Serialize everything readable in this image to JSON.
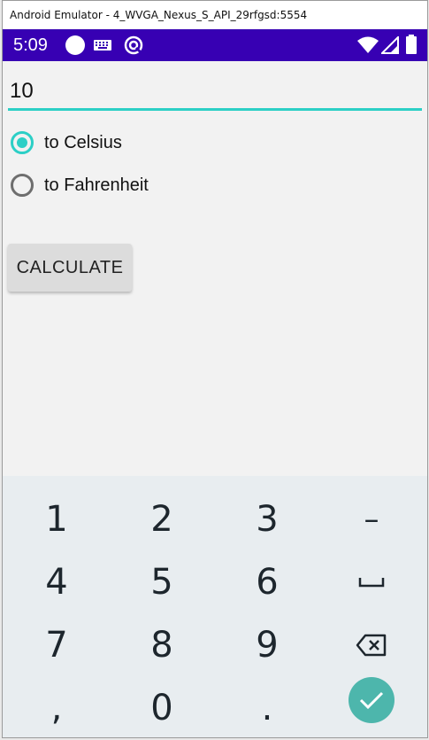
{
  "window": {
    "title": "Android Emulator - 4_WVGA_Nexus_S_API_29rfgsd:5554"
  },
  "status_bar": {
    "time": "5:09",
    "icons": [
      "circle-notification-icon",
      "keyboard-icon",
      "at-sign-icon",
      "wifi-icon",
      "signal-icon",
      "battery-icon"
    ],
    "background": "#3700b3"
  },
  "form": {
    "temperature_value": "10",
    "options": [
      {
        "label": "to Celsius",
        "checked": true
      },
      {
        "label": "to Fahrenheit",
        "checked": false
      }
    ],
    "calculate_label": "CALCULATE",
    "accent": "#2ccfc6"
  },
  "keyboard": {
    "row1": [
      "1",
      "2",
      "3",
      "–"
    ],
    "row2": [
      "4",
      "5",
      "6",
      "␣"
    ],
    "row3": [
      "7",
      "8",
      "9",
      "backspace-icon"
    ],
    "row4": [
      ",",
      "0",
      ".",
      "done-check-icon"
    ]
  }
}
